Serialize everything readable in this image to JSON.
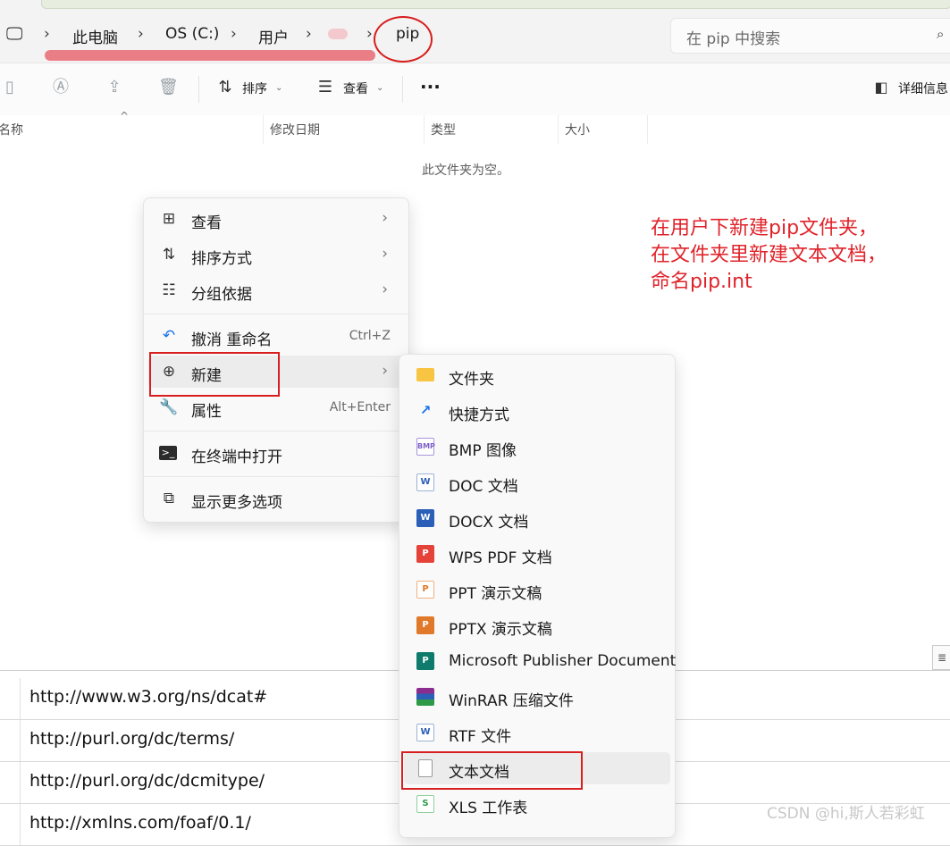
{
  "address": {
    "crumbs": [
      "此电脑",
      "OS (C:)",
      "用户",
      "pip"
    ],
    "chevron": "›",
    "search_placeholder": "在 pip 中搜索"
  },
  "toolbar": {
    "sort_label": "排序",
    "view_label": "查看",
    "more_label": "···",
    "details_label": "详细信息"
  },
  "columns": [
    "名称",
    "修改日期",
    "类型",
    "大小"
  ],
  "empty_message": "此文件夹为空。",
  "annotation": [
    "在用户下新建pip文件夹，",
    "在文件夹里新建文本文档，",
    "命名pip.int"
  ],
  "context_menu": {
    "items": [
      {
        "label": "查看",
        "icon": "grid-icon",
        "submenu": true
      },
      {
        "label": "排序方式",
        "icon": "sort-icon",
        "submenu": true
      },
      {
        "label": "分组依据",
        "icon": "group-list-icon",
        "submenu": true
      },
      {
        "label": "撤消 重命名",
        "icon": "undo-icon",
        "shortcut": "Ctrl+Z"
      },
      {
        "label": "新建",
        "icon": "new-plus-icon",
        "submenu": true
      },
      {
        "label": "属性",
        "icon": "wrench-icon",
        "shortcut": "Alt+Enter"
      },
      {
        "label": "在终端中打开",
        "icon": "terminal-icon"
      },
      {
        "label": "显示更多选项",
        "icon": "expand-icon"
      }
    ]
  },
  "submenu": {
    "items": [
      {
        "label": "文件夹",
        "icon": "folder-icon"
      },
      {
        "label": "快捷方式",
        "icon": "shortcut-arrow-icon"
      },
      {
        "label": "BMP 图像",
        "icon": "bmp-file-icon",
        "tag": "BMP"
      },
      {
        "label": "DOC 文档",
        "icon": "word-doc-icon",
        "tag": "W"
      },
      {
        "label": "DOCX 文档",
        "icon": "word-docx-icon",
        "tag": "W"
      },
      {
        "label": "WPS PDF 文档",
        "icon": "wps-pdf-icon",
        "tag": "P"
      },
      {
        "label": "PPT 演示文稿",
        "icon": "ppt-icon",
        "tag": "P"
      },
      {
        "label": "PPTX 演示文稿",
        "icon": "pptx-icon",
        "tag": "P"
      },
      {
        "label": "Microsoft Publisher Document",
        "icon": "publisher-icon",
        "tag": "P"
      },
      {
        "label": "WinRAR 压缩文件",
        "icon": "winrar-icon"
      },
      {
        "label": "RTF 文件",
        "icon": "rtf-icon",
        "tag": "W"
      },
      {
        "label": "文本文档",
        "icon": "text-document-icon"
      },
      {
        "label": "XLS 工作表",
        "icon": "xls-icon",
        "tag": "S"
      }
    ]
  },
  "background_table": {
    "rows": [
      "http://www.w3.org/ns/dcat#",
      "http://purl.org/dc/terms/",
      "http://purl.org/dc/dcmitype/",
      "http://xmlns.com/foaf/0.1/"
    ]
  },
  "watermark": "CSDN @hi,斯人若彩虹",
  "colors": {
    "annotation_red": "#e0232a",
    "highlight_box": "#d81e1e",
    "redaction_pink": "#e9747d"
  }
}
